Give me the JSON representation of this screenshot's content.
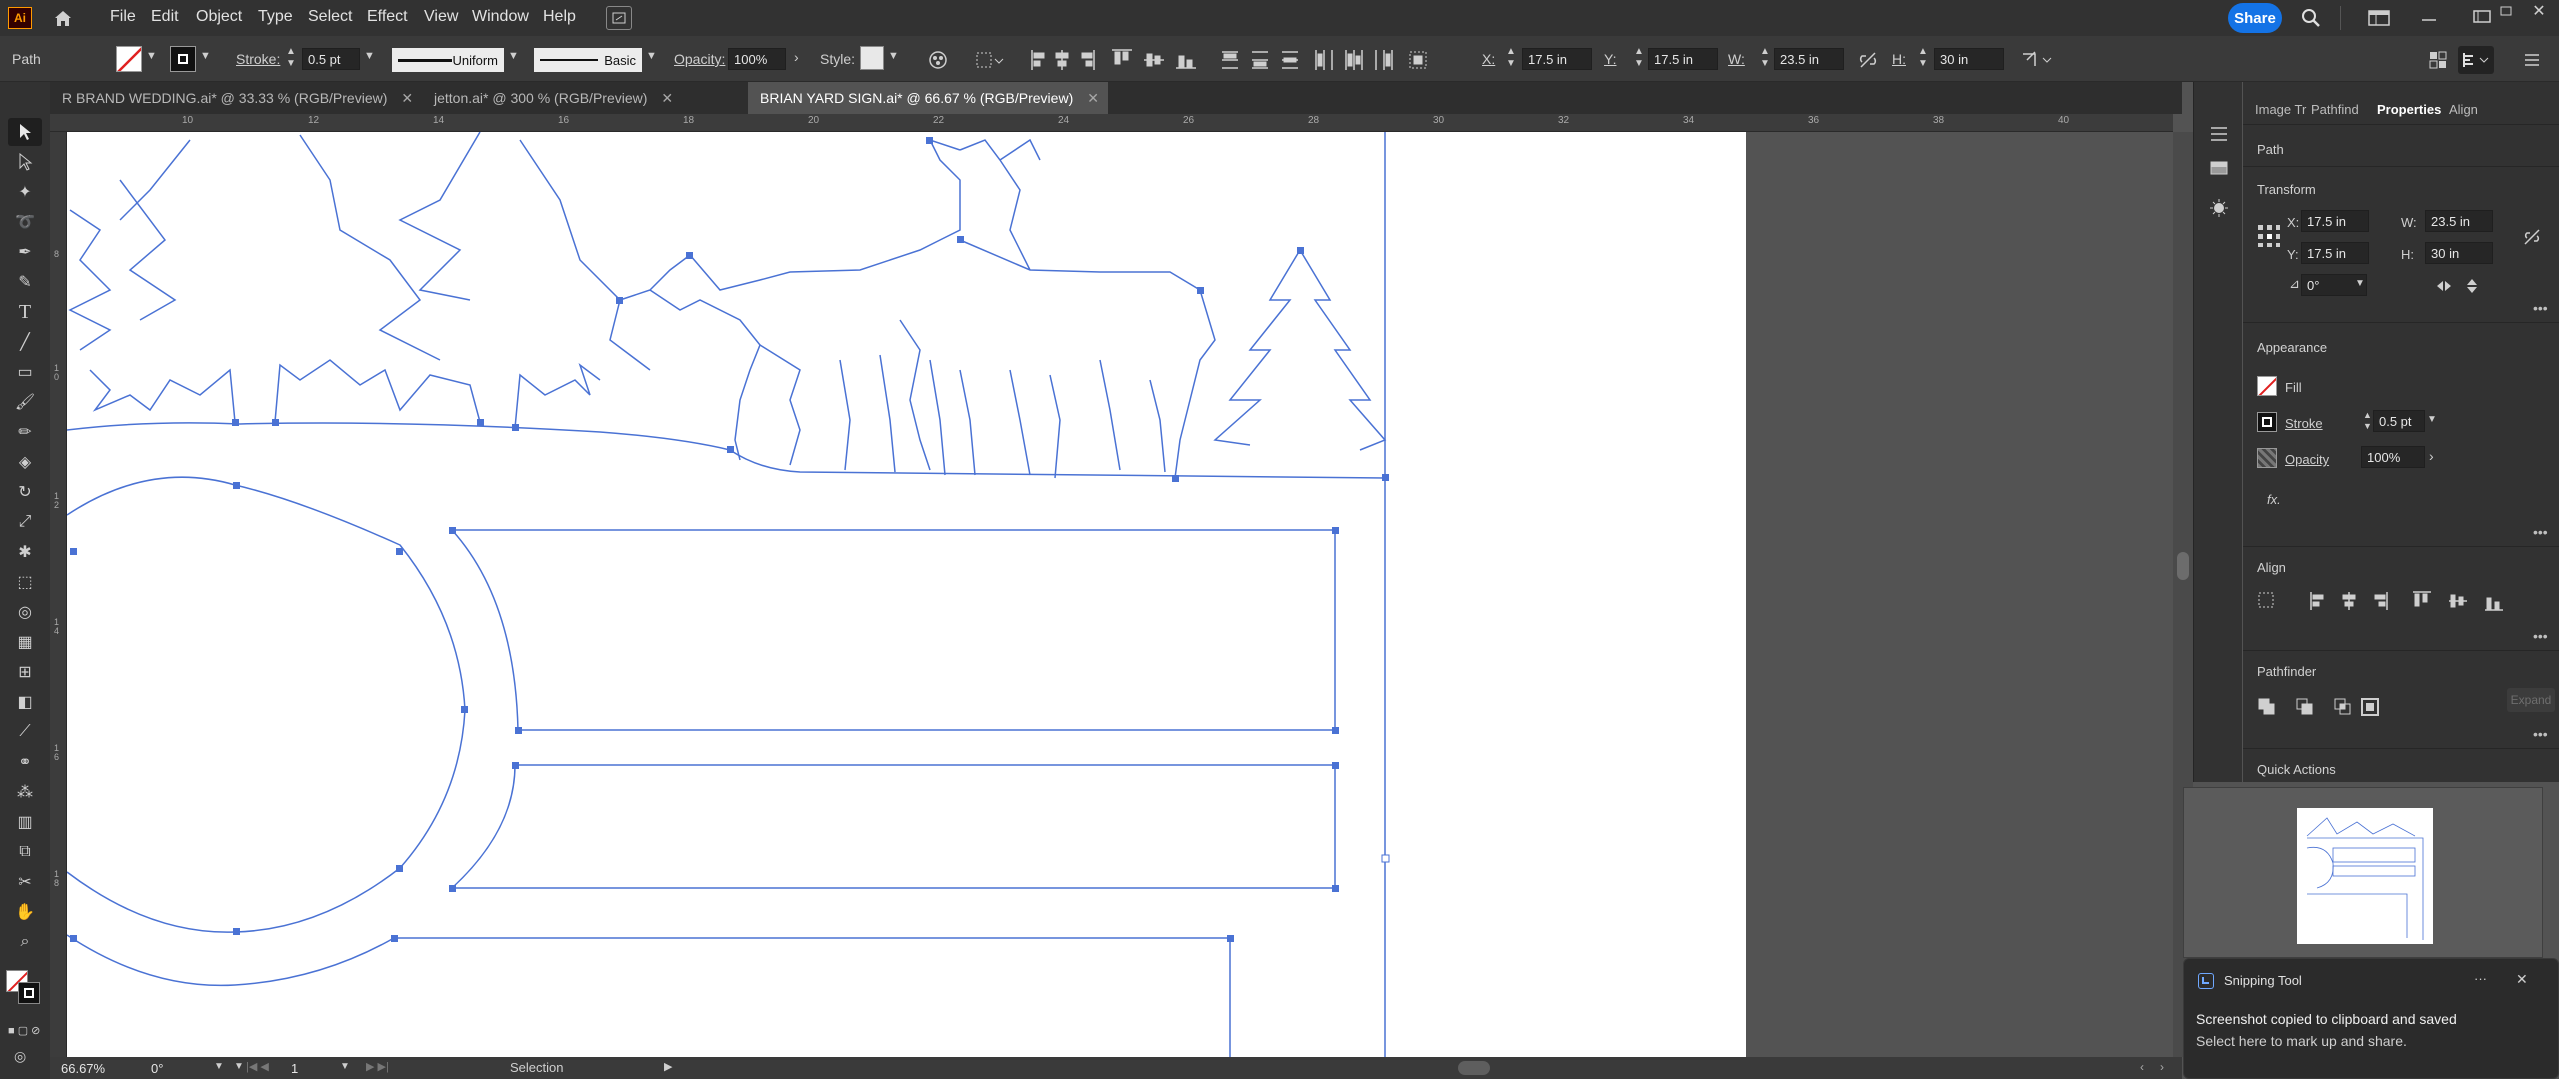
{
  "app": {
    "logo": "Ai",
    "share_label": "Share",
    "menus": [
      "File",
      "Edit",
      "Object",
      "Type",
      "Select",
      "Effect",
      "View",
      "Window",
      "Help"
    ]
  },
  "control": {
    "selection_type": "Path",
    "stroke_label": "Stroke:",
    "stroke_value": "0.5 pt",
    "stroke_profile": "Uniform",
    "brush": "Basic",
    "opacity_label": "Opacity:",
    "opacity_value": "100%",
    "style_label": "Style:",
    "x_label": "X:",
    "x_value": "17.5 in",
    "y_label": "Y:",
    "y_value": "17.5 in",
    "w_label": "W:",
    "w_value": "23.5 in",
    "h_label": "H:",
    "h_value": "30 in"
  },
  "tabs": [
    {
      "label": "R BRAND WEDDING.ai* @ 33.33 % (RGB/Preview)",
      "active": false
    },
    {
      "label": "jetton.ai* @ 300 % (RGB/Preview)",
      "active": false
    },
    {
      "label": "BRIAN YARD SIGN.ai* @ 66.67 % (RGB/Preview)",
      "active": true
    }
  ],
  "ruler": {
    "h_ticks": [
      "10",
      "12",
      "14",
      "16",
      "18",
      "20",
      "22",
      "24",
      "26",
      "28",
      "30",
      "32",
      "34",
      "36",
      "38",
      "40"
    ],
    "v_ticks": [
      "8",
      "1\n0",
      "1\n2",
      "1\n4",
      "1\n6",
      "1\n8"
    ]
  },
  "status": {
    "zoom": "66.67%",
    "rotation": "0°",
    "artboard": "1",
    "tool": "Selection"
  },
  "panel": {
    "tabs": [
      "Image Tr",
      "Pathfind",
      "Properties",
      "Align"
    ],
    "active_tab": "Properties",
    "object_type": "Path",
    "transform": {
      "title": "Transform",
      "x_label": "X:",
      "x": "17.5 in",
      "y_label": "Y:",
      "y": "17.5 in",
      "w_label": "W:",
      "w": "23.5 in",
      "h_label": "H:",
      "h": "30 in",
      "angle": "0°"
    },
    "appearance": {
      "title": "Appearance",
      "fill": "Fill",
      "stroke": "Stroke",
      "stroke_value": "0.5 pt",
      "opacity": "Opacity",
      "opacity_value": "100%",
      "fx": "fx."
    },
    "align": {
      "title": "Align"
    },
    "pathfinder": {
      "title": "Pathfinder",
      "expand": "Expand"
    },
    "quick_actions": {
      "title": "Quick Actions"
    }
  },
  "toast": {
    "app": "Snipping Tool",
    "line1": "Screenshot copied to clipboard and saved",
    "line2": "Select here to mark up and share."
  },
  "colors": {
    "accent": "#1473e6",
    "path": "#4a72d4",
    "chrome": "#323232",
    "canvas": "#535353"
  }
}
